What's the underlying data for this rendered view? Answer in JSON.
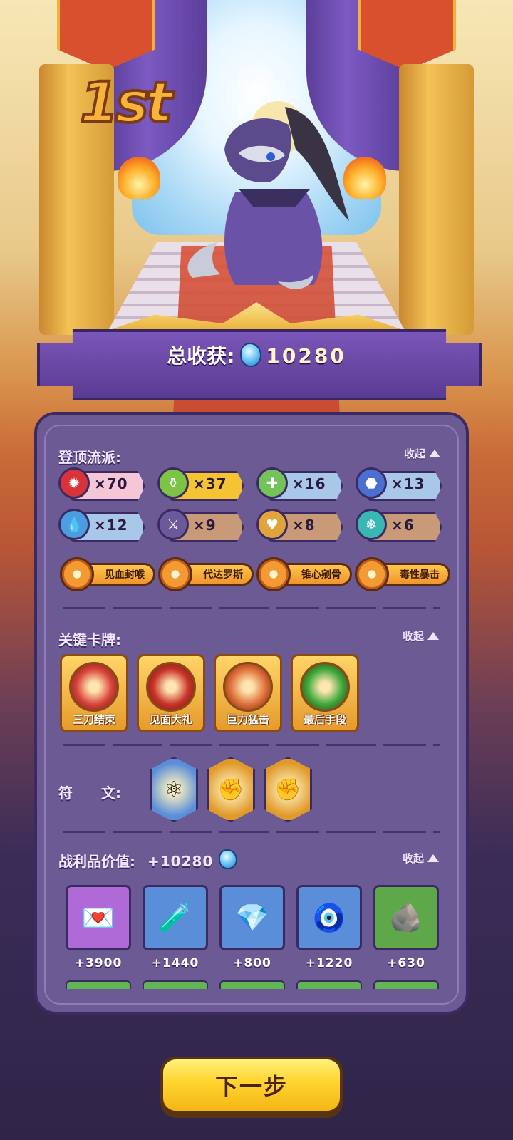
{
  "result": {
    "rank": "1st",
    "total_label": "总收获:",
    "total_value": "10280"
  },
  "build": {
    "title": "登顶流派:",
    "collapse_label": "收起",
    "factions": [
      {
        "icon": "claw-icon",
        "count": "×70",
        "color": "#f4c6d6",
        "icon_color": "#d8323a"
      },
      {
        "icon": "potion-icon",
        "count": "×37",
        "color": "#f5c433",
        "icon_color": "#7cc443"
      },
      {
        "icon": "cross-heal-icon",
        "count": "×16",
        "color": "#a9c7e8",
        "icon_color": "#74c25a"
      },
      {
        "icon": "boot-icon",
        "count": "×13",
        "color": "#a9c7e8",
        "icon_color": "#4a6fd0"
      },
      {
        "icon": "water-drop-icon",
        "count": "×12",
        "color": "#a9c7e8",
        "icon_color": "#4b9de0"
      },
      {
        "icon": "sword-icon",
        "count": "×9",
        "color": "#c99a78",
        "icon_color": "#6a5a9a"
      },
      {
        "icon": "heart-icon",
        "count": "×8",
        "color": "#c99a78",
        "icon_color": "#e0a43a"
      },
      {
        "icon": "snowflake-icon",
        "count": "×6",
        "color": "#c99a78",
        "icon_color": "#39b7b5"
      }
    ],
    "skills": [
      "见血封喉",
      "代达罗斯",
      "锥心剜骨",
      "毒性暴击"
    ]
  },
  "key_cards": {
    "title": "关键卡牌:",
    "collapse_label": "收起",
    "cards": [
      {
        "name": "三刀结束",
        "art_color": "#d8423a"
      },
      {
        "name": "见面大礼",
        "art_color": "#c8322a"
      },
      {
        "name": "巨力猛击",
        "art_color": "#e0703a"
      },
      {
        "name": "最后手段",
        "art_color": "#3aa83a"
      }
    ]
  },
  "runes": {
    "title": "符　　文:",
    "items": [
      {
        "icon": "atom-sprite-icon",
        "color": "#5a8ed8"
      },
      {
        "icon": "gold-fist-icon",
        "color": "#e09a2a"
      },
      {
        "icon": "gold-fist-icon",
        "color": "#e09a2a"
      }
    ]
  },
  "loot": {
    "title": "战利品价值:",
    "total": "+10280",
    "collapse_label": "收起",
    "items": [
      {
        "icon": "gift-letter-icon",
        "value": "+3900",
        "color": "#b06ad8"
      },
      {
        "icon": "potion-bottle-icon",
        "value": "+1440",
        "color": "#5a8ed8"
      },
      {
        "icon": "crystal-icon",
        "value": "+800",
        "color": "#5a8ed8"
      },
      {
        "icon": "eye-amulet-icon",
        "value": "+1220",
        "color": "#5a8ed8"
      },
      {
        "icon": "rune-tablet-icon",
        "value": "+630",
        "color": "#5fa84a"
      }
    ]
  },
  "actions": {
    "next_label": "下一步"
  }
}
